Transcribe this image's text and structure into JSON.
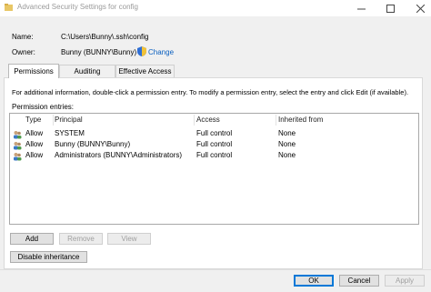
{
  "window": {
    "title": "Advanced Security Settings for config"
  },
  "info": {
    "name_label": "Name:",
    "name_value": "C:\\Users\\Bunny\\.ssh\\config",
    "owner_label": "Owner:",
    "owner_value": "Bunny (BUNNY\\Bunny)",
    "change_link": "Change"
  },
  "tabs": [
    {
      "label": "Permissions",
      "active": true
    },
    {
      "label": "Auditing",
      "active": false
    },
    {
      "label": "Effective Access",
      "active": false
    }
  ],
  "permissions": {
    "info_text": "For additional information, double-click a permission entry. To modify a permission entry, select the entry and click Edit (if available).",
    "entries_label": "Permission entries:",
    "columns": [
      "Type",
      "Principal",
      "Access",
      "Inherited from"
    ],
    "rows": [
      {
        "type": "Allow",
        "principal": "SYSTEM",
        "access": "Full control",
        "inherited": "None"
      },
      {
        "type": "Allow",
        "principal": "Bunny (BUNNY\\Bunny)",
        "access": "Full control",
        "inherited": "None"
      },
      {
        "type": "Allow",
        "principal": "Administrators (BUNNY\\Administrators)",
        "access": "Full control",
        "inherited": "None"
      }
    ],
    "buttons": {
      "add": "Add",
      "remove": "Remove",
      "view": "View",
      "disable_inheritance": "Disable inheritance"
    }
  },
  "footer": {
    "ok": "OK",
    "cancel": "Cancel",
    "apply": "Apply"
  },
  "colors": {
    "link": "#0a5fbf",
    "accent": "#0078d7"
  }
}
